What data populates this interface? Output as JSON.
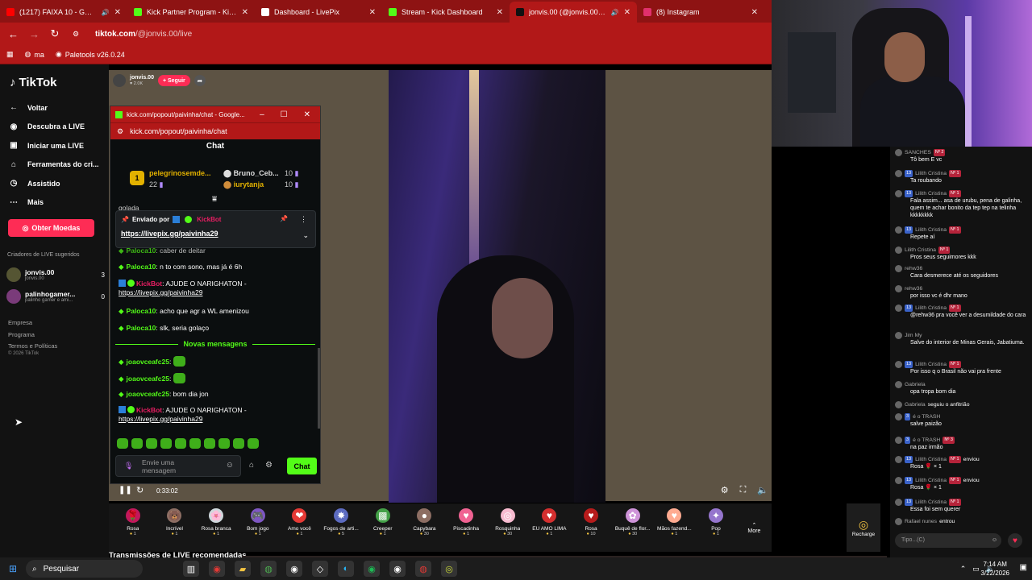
{
  "browser": {
    "tabs": [
      {
        "label": "(1217) FAIXA 10 - GAUCHIN",
        "color": "#ff0000",
        "icon": "youtube-icon",
        "audio": true
      },
      {
        "label": "Kick Partner Program - Kick Da",
        "color": "#53fc18",
        "icon": "kick-icon"
      },
      {
        "label": "Dashboard - LivePix",
        "color": "#ffffff",
        "icon": "livepix-icon"
      },
      {
        "label": "Stream - Kick Dashboard",
        "color": "#53fc18",
        "icon": "kick-icon"
      },
      {
        "label": "jonvis.00 (@jonvis.00) come",
        "color": "#111111",
        "icon": "tiktok-icon",
        "audio": true,
        "active": true
      },
      {
        "label": "(8) Instagram",
        "color": "#e1306c",
        "icon": "instagram-icon"
      }
    ],
    "url_host": "tiktok.com",
    "url_path": "/@jonvis.00/live",
    "bookmarks": [
      {
        "label": "ma",
        "icon": "whatsapp-icon"
      },
      {
        "label": "Paletools v26.0.24",
        "icon": "paletools-icon"
      }
    ]
  },
  "tiktok": {
    "logo": "TikTok",
    "nav": [
      {
        "label": "Voltar",
        "icon": "arrow-left-icon"
      },
      {
        "label": "Descubra a LIVE",
        "icon": "compass-icon"
      },
      {
        "label": "Iniciar uma LIVE",
        "icon": "camera-icon"
      },
      {
        "label": "Ferramentas do cri...",
        "icon": "home-icon"
      },
      {
        "label": "Assistido",
        "icon": "history-icon"
      },
      {
        "label": "Mais",
        "icon": "more-icon"
      }
    ],
    "coins_button": "Obter Moedas",
    "creators_title": "Criadores de LIVE sugeridos",
    "creators": [
      {
        "name": "jonvis.00",
        "sub": "jonvis.00",
        "count": "3"
      },
      {
        "name": "palinhogamer...",
        "sub": "palinho gamer e ami...",
        "count": "0"
      }
    ],
    "links": [
      "Empresa",
      "Programa",
      "Termos e Políticas"
    ],
    "copyright": "© 2026 TikTok",
    "streamer": {
      "name": "jonvis.00",
      "viewers": "2.0K",
      "follow": "+ Seguir"
    },
    "time": "0:33:02",
    "gifts": [
      {
        "name": "Rosa",
        "price": "1",
        "glyph": "🌹",
        "color": "#c2185b"
      },
      {
        "name": "Incrível",
        "price": "1",
        "glyph": "🐻",
        "color": "#8d6e63"
      },
      {
        "name": "Rosa branca",
        "price": "1",
        "glyph": "🌸",
        "color": "#cfd8dc"
      },
      {
        "name": "Bom jogo",
        "price": "1",
        "glyph": "🎮",
        "color": "#7e57c2"
      },
      {
        "name": "Amo você",
        "price": "1",
        "glyph": "❤",
        "color": "#e53935"
      },
      {
        "name": "Fogos de arti...",
        "price": "5",
        "glyph": "✸",
        "color": "#5c6bc0"
      },
      {
        "name": "Creeper",
        "price": "1",
        "glyph": "▩",
        "color": "#43a047"
      },
      {
        "name": "Capybara",
        "price": "30",
        "glyph": "●",
        "color": "#8d6e63"
      },
      {
        "name": "Piscadinha",
        "price": "1",
        "glyph": "♥",
        "color": "#f06292"
      },
      {
        "name": "Rosquinha",
        "price": "30",
        "glyph": "◎",
        "color": "#f8bbd0"
      },
      {
        "name": "EU AMO LIMA",
        "price": "1",
        "glyph": "♥",
        "color": "#d32f2f"
      },
      {
        "name": "Rosa",
        "price": "10",
        "glyph": "♥",
        "color": "#b71c1c"
      },
      {
        "name": "Buquê de flor...",
        "price": "30",
        "glyph": "✿",
        "color": "#ce93d8"
      },
      {
        "name": "Mãos fazend...",
        "price": "1",
        "glyph": "♥",
        "color": "#ffab91"
      },
      {
        "name": "Pop",
        "price": "1",
        "glyph": "✦",
        "color": "#9575cd"
      }
    ],
    "more_label": "More",
    "recharge_label": "Recharge",
    "recommended_title": "Transmissões de LIVE recomendadas"
  },
  "kick": {
    "window_title": "kick.com/popout/paivinha/chat - Google...",
    "url": "kick.com/popout/paivinha/chat",
    "chat_title": "Chat",
    "leaderboard": {
      "rank": "1",
      "first": {
        "name": "pelegrinosemde...",
        "value": "22"
      },
      "second": {
        "name": "Bruno_Ceb...",
        "value": "10"
      },
      "third": {
        "name": "iurytanja",
        "value": "10"
      }
    },
    "cut_text": "golada",
    "pinned": {
      "prefix": "Enviado por",
      "author": "KickBot",
      "link": "https://livepix.gg/paivinha29"
    },
    "messages": [
      {
        "user": "Paloca10",
        "text": ": caber de deitar"
      },
      {
        "user": "Paloca10",
        "text": ": n to com sono, mas já é 6h"
      },
      {
        "user": "KickBot",
        "text": ": AJUDE O NARIGHATON -",
        "link": "https://livepix.gg/paivinha29"
      },
      {
        "user": "Paloca10",
        "text": ": acho que agr a WL amenizou"
      },
      {
        "user": "Paloca10",
        "text": ": slk, seria golaço"
      }
    ],
    "new_messages": "Novas mensagens",
    "new": [
      {
        "user": "joaovceafc25",
        "text": ":"
      },
      {
        "user": "joaovceafc25",
        "text": ":"
      },
      {
        "user": "joaovceafc25",
        "text": ": bom dia jon"
      },
      {
        "user": "KickBot",
        "text": ": AJUDE O NARIGHATON -",
        "link": "https://livepix.gg/paivinha29"
      }
    ],
    "input_placeholder": "Envie uma mensagem",
    "send_button": "Chat"
  },
  "tiktok_chat": [
    {
      "user": "SANCHES",
      "rank": "Nº 2",
      "text": "Tô bem E vc"
    },
    {
      "user": "Lilith Cristina",
      "lv": "13",
      "rank": "Nº 1",
      "text": "Ta roubando"
    },
    {
      "user": "Lilith Cristina",
      "lv": "13",
      "rank": "Nº 1",
      "text": "Fala assim... asa de urubu, pena de galinha, quem te achar bonito da tep tep na telinha kkkkkkkk"
    },
    {
      "user": "Lilith Cristina",
      "lv": "13",
      "rank": "Nº 1",
      "text": "Repete aí"
    },
    {
      "user": "Lilith Cristina",
      "rank": "Nº 1",
      "text": "Pros seus seguimores kkk"
    },
    {
      "user": "rehw36",
      "text": "Cara desmerece até os seguidores"
    },
    {
      "user": "rehw36",
      "text": "por isso vc é dhr mano"
    },
    {
      "user": "Lilith Cristina",
      "lv": "13",
      "rank": "Nº 1",
      "text": "@rehw36 pra você ver a desumildade do cara"
    },
    {
      "user": "Jim My",
      "text": "Salve do interior de Minas Gerais, Jabatiuma."
    },
    {
      "user": "Lilith Cristina",
      "lv": "13",
      "rank": "Nº 1",
      "text": "Por isso q o Brasil não vai pra frente"
    },
    {
      "user": "Gabriela",
      "text": "opa tropa bom dia"
    },
    {
      "user": "Gabriela",
      "text": "seguiu o anfitrião",
      "inline": true
    },
    {
      "user": "é o TRASH",
      "lv": "3",
      "text": "salve paizão"
    },
    {
      "user": "é o TRASH",
      "lv": "3",
      "rank": "Nº 3",
      "text": "na paz irmão"
    },
    {
      "user": "Lilith Cristina",
      "lv": "13",
      "rank": "Nº 1",
      "suffix": "enviou",
      "text": "Rosa 🌹 × 1"
    },
    {
      "user": "Lilith Cristina",
      "lv": "13",
      "rank": "Nº 1",
      "suffix": "enviou",
      "text": "Rosa 🌹 × 1"
    },
    {
      "user": "Lilith Cristina",
      "lv": "13",
      "rank": "Nº 1",
      "text": "Essa foi sem querer"
    },
    {
      "user": "Rafael nunes",
      "text": "entrou",
      "inline": true
    }
  ],
  "tiktok_chat_input": "Tipo...(C)",
  "taskbar": {
    "search": "Pesquisar",
    "time": "7:14 AM",
    "date": "3/22/2026"
  }
}
